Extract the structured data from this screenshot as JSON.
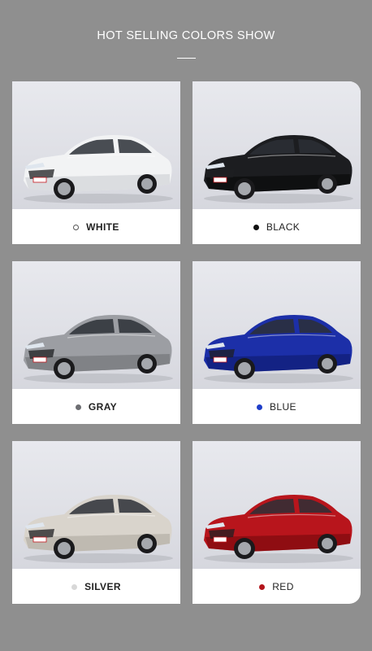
{
  "header": {
    "title": "HOT SELLING COLORS SHOW"
  },
  "colors": [
    {
      "label": "WHITE",
      "dot": "#ffffff",
      "dot_border": "#555555",
      "body": "#f2f3f4",
      "shade": "#c9cbd0",
      "bold": true
    },
    {
      "label": "BLACK",
      "dot": "#111111",
      "dot_border": "#111111",
      "body": "#1c1d20",
      "shade": "#050505",
      "bold": false
    },
    {
      "label": "GRAY",
      "dot": "#6d6e72",
      "dot_border": "#6d6e72",
      "body": "#9c9ea3",
      "shade": "#6a6c70",
      "bold": true
    },
    {
      "label": "BLUE",
      "dot": "#1f3ec9",
      "dot_border": "#1f3ec9",
      "body": "#1c2fa8",
      "shade": "#0d1766",
      "bold": false
    },
    {
      "label": "SILVER",
      "dot": "#d8d8d8",
      "dot_border": "#d8d8d8",
      "body": "#d9d4cc",
      "shade": "#aaa49b",
      "bold": true
    },
    {
      "label": "RED",
      "dot": "#b3141b",
      "dot_border": "#b3141b",
      "body": "#b8151c",
      "shade": "#6d070b",
      "bold": false
    }
  ]
}
